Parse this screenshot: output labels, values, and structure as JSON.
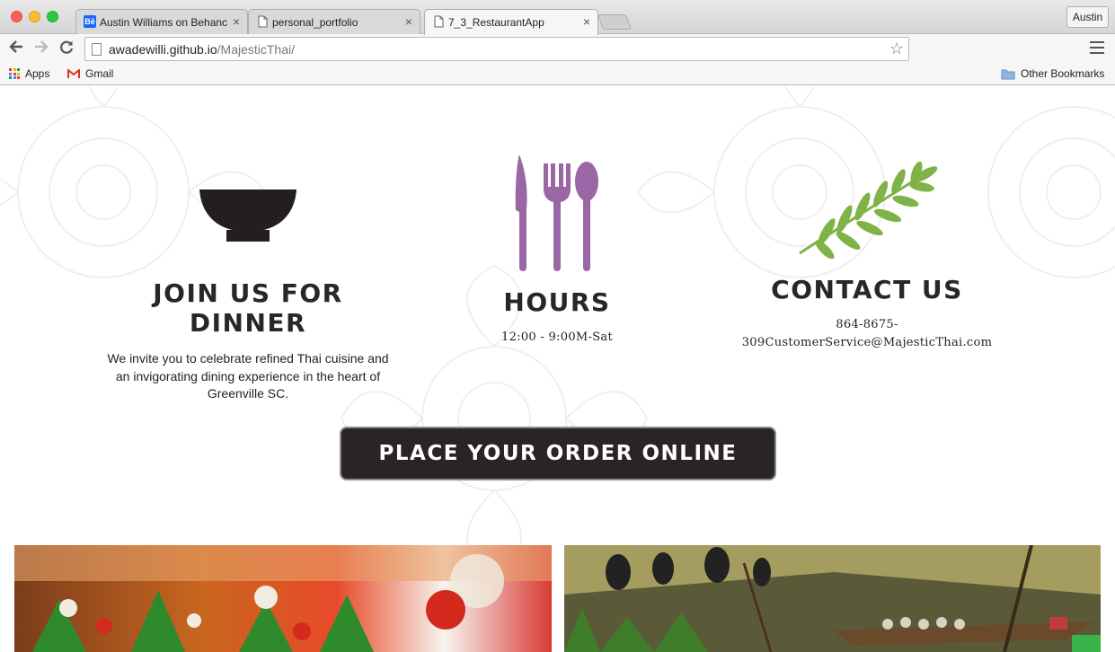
{
  "browser": {
    "tabs": [
      {
        "title": "Austin Williams on Behance",
        "icon": "behance-icon",
        "active": false
      },
      {
        "title": "personal_portfolio",
        "icon": "page-icon",
        "active": false
      },
      {
        "title": "7_3_RestaurantApp",
        "icon": "page-icon",
        "active": true
      }
    ],
    "profile_name": "Austin",
    "url_host": "awadewilli.github.io",
    "url_path": "/MajesticThai/",
    "bookmarks": [
      {
        "label": "Apps",
        "icon": "apps-grid-icon"
      },
      {
        "label": "Gmail",
        "icon": "gmail-icon"
      }
    ],
    "other_bookmarks": "Other Bookmarks",
    "behance_badge": "Bē"
  },
  "page": {
    "dinner": {
      "icon": "bowl-icon",
      "title_line1": "JOIN US FOR",
      "title_line2": "DINNER",
      "text": "We invite you to celebrate refined Thai cuisine and an invigorating dining experience in the heart of Greenville SC."
    },
    "hours": {
      "icon": "utensils-icon",
      "title": "HOURS",
      "text": "12:00 - 9:00M-Sat",
      "accent": "#9b66a6"
    },
    "contact": {
      "icon": "leaf-icon",
      "title": "CONTACT US",
      "text_line1": "864-8675-",
      "text_line2": "309CustomerService@MajesticThai.com",
      "accent": "#7fb247"
    },
    "order_button": "PLACE YOUR ORDER ONLINE",
    "colors": {
      "dark": "#2a2424",
      "text": "#222222"
    }
  }
}
